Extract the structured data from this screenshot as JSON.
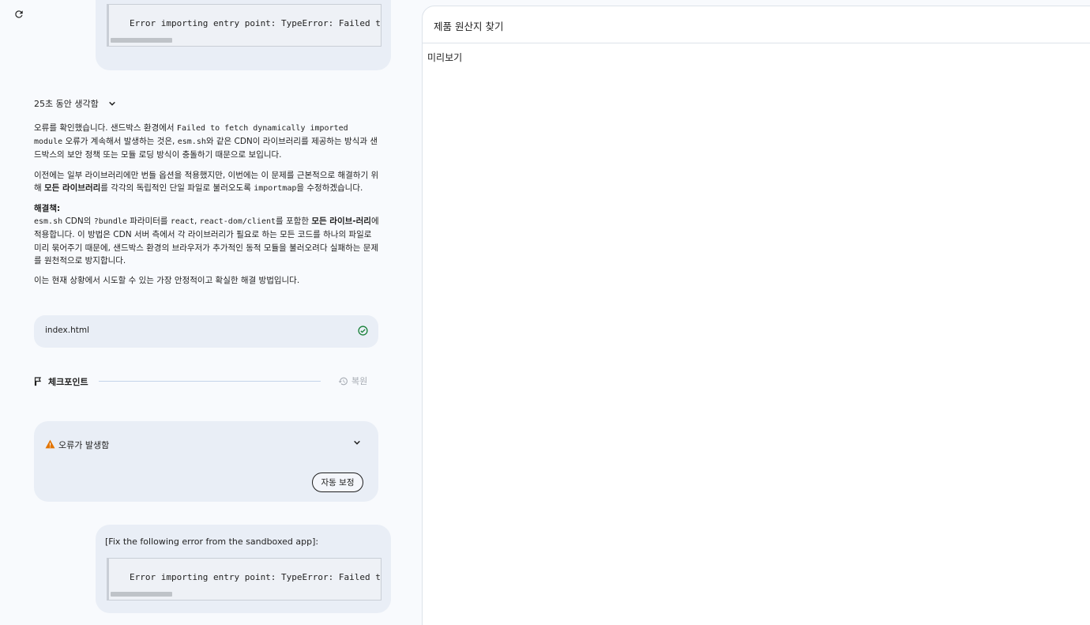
{
  "refresh_icon": "refresh-icon",
  "bubble_top": {
    "code": "Error importing entry point: TypeError: Failed t"
  },
  "thinking": {
    "label": "25초 동안 생각함",
    "icon": "chevron-down-icon"
  },
  "answer": {
    "p1_a": "오류를 확인했습니다. 샌드박스 환경에서 ",
    "p1_code1": "Failed to fetch dynamically imported module",
    "p1_b": " 오류가 계속해서 발생하는 것은, ",
    "p1_code2": "esm.sh",
    "p1_c": "와 같은 CDN이 라이브러리를 제공하는 방식과 샌드박스의 보안 정책 또는 모듈 로딩 방식이 충돌하기 때문으로 보입니다.",
    "p2_a": "이전에는 일부 라이브러리에만 번들 옵션을 적용했지만, 이번에는 이 문제를 근본적으로 해결하기 위해 ",
    "p2_bold": "모든 라이브러리",
    "p2_b": "를 각각의 독립적인 단일 파일로 불러오도록 ",
    "p2_code": "importmap",
    "p2_c": "을 수정하겠습니다.",
    "solution_title": "해결책:",
    "s_code1": "esm.sh",
    "s_a": " CDN의 ",
    "s_code2": "?bundle",
    "s_b": " 파라미터를 ",
    "s_code3": "react",
    "s_c": ", ",
    "s_code4": "react-dom/client",
    "s_d": "를 포함한 ",
    "s_bold": "모든 라이브-러리",
    "s_e": "에 적용합니다. 이 방법은 CDN 서버 측에서 각 라이브러리가 필요로 하는 모든 코드를 하나의 파일로 미리 묶어주기 때문에, 샌드박스 환경의 브라우저가 추가적인 동적 모듈을 불러오려다 실패하는 문제를 원천적으로 방지합니다.",
    "p4": "이는 현재 상황에서 시도할 수 있는 가장 안정적이고 확실한 해결 방법입니다."
  },
  "file_chip": {
    "name": "index.html",
    "status_icon": "check-circle-icon",
    "status_color": "#188038"
  },
  "checkpoint": {
    "label": "체크포인트",
    "restore_label": "복원",
    "flag_icon": "flag-icon",
    "restore_icon": "history-icon"
  },
  "error_card": {
    "title": "오류가 발생함",
    "warn_icon": "warning-icon",
    "warn_color": "#e37400",
    "fix_label": "자동 보정"
  },
  "bubble_bottom": {
    "text": "[Fix the following error from the sandboxed app]:",
    "code": "Error importing entry point: TypeError: Failed t"
  },
  "preview": {
    "title": "제품 원산지 찾기",
    "body": "미리보기"
  }
}
